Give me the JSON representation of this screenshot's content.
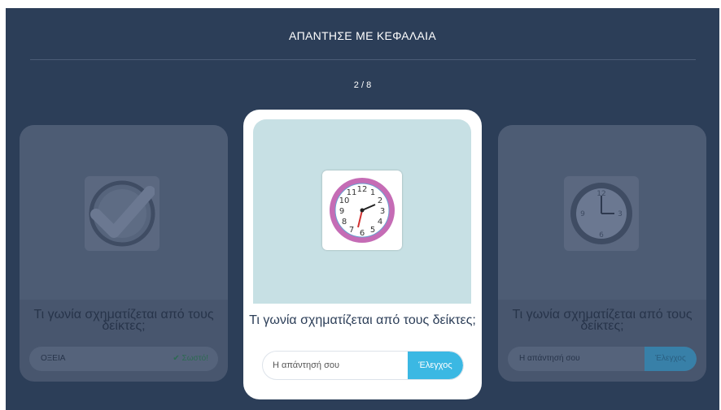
{
  "header": {
    "title": "ΑΠΑΝΤΗΣΕ ΜΕ ΚΕΦΑΛΑΙΑ",
    "counter": "2 / 8"
  },
  "cards": {
    "previous": {
      "question": "Τι γωνία σχηματίζεται από τους δείκτες;",
      "answer": "ΟΞΕΙΑ",
      "status": "✔ Σωστό!",
      "image": "clock-icon"
    },
    "current": {
      "question": "Τι γωνία σχηματίζεται από τους δείκτες;",
      "placeholder": "Η απάντησή σου",
      "button_label": "Έλεγχος",
      "image": "clock-icon"
    },
    "next": {
      "question": "Τι γωνία σχηματίζεται από τους δείκτες;",
      "placeholder": "Η απάντησή σου",
      "button_label": "Έλεγχος",
      "image": "clock-icon"
    }
  },
  "colors": {
    "background": "#2c3e58",
    "accent": "#3bb8e3",
    "image_bg": "#c7e0e4",
    "clock_rim": "#c56cb5"
  }
}
